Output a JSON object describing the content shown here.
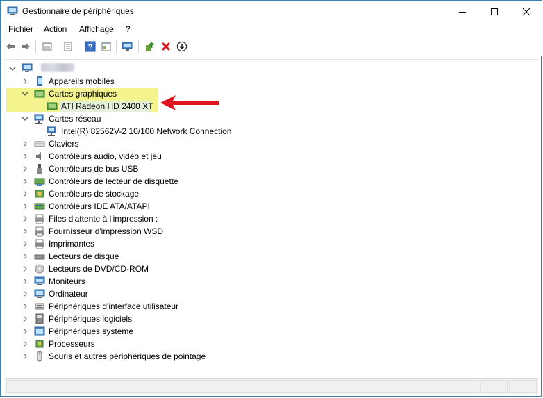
{
  "window": {
    "title": "Gestionnaire de périphériques"
  },
  "menu": [
    {
      "label": "Fichier"
    },
    {
      "label": "Action"
    },
    {
      "label": "Affichage"
    },
    {
      "label": "?"
    }
  ],
  "toolbar": {
    "buttons": [
      "back-icon",
      "forward-icon",
      "properties-icon",
      "update-list-icon",
      "help-icon",
      "view-icon",
      "scan-computer-icon",
      "update-driver-icon",
      "uninstall-icon",
      "disable-icon"
    ]
  },
  "tree": {
    "root_label_blurred": true,
    "categories": [
      {
        "label": "Appareils mobiles",
        "icon": "mobile-icon",
        "expanded": false
      },
      {
        "label": "Cartes graphiques",
        "icon": "display-adapter-icon",
        "expanded": true,
        "children": [
          {
            "label": "ATI Radeon HD 2400 XT",
            "icon": "display-adapter-icon",
            "selected": true
          }
        ]
      },
      {
        "label": "Cartes réseau",
        "icon": "network-icon",
        "expanded": true,
        "children": [
          {
            "label": "Intel(R) 82562V-2 10/100 Network Connection",
            "icon": "network-icon"
          }
        ]
      },
      {
        "label": "Claviers",
        "icon": "keyboard-icon",
        "expanded": false
      },
      {
        "label": "Contrôleurs audio, vidéo et jeu",
        "icon": "speaker-icon",
        "expanded": false
      },
      {
        "label": "Contrôleurs de bus USB",
        "icon": "usb-icon",
        "expanded": false
      },
      {
        "label": "Contrôleurs de lecteur de disquette",
        "icon": "floppy-controller-icon",
        "expanded": false
      },
      {
        "label": "Contrôleurs de stockage",
        "icon": "storage-controller-icon",
        "expanded": false
      },
      {
        "label": "Contrôleurs IDE ATA/ATAPI",
        "icon": "ide-icon",
        "expanded": false
      },
      {
        "label": "Files d'attente à l'impression :",
        "icon": "print-queue-icon",
        "expanded": false
      },
      {
        "label": "Fournisseur d'impression WSD",
        "icon": "printer-icon",
        "expanded": false
      },
      {
        "label": "Imprimantes",
        "icon": "printer-icon",
        "expanded": false
      },
      {
        "label": "Lecteurs de disque",
        "icon": "disk-drive-icon",
        "expanded": false
      },
      {
        "label": "Lecteurs de DVD/CD-ROM",
        "icon": "dvd-icon",
        "expanded": false
      },
      {
        "label": "Moniteurs",
        "icon": "monitor-icon",
        "expanded": false
      },
      {
        "label": "Ordinateur",
        "icon": "computer-icon",
        "expanded": false
      },
      {
        "label": "Périphériques d'interface utilisateur",
        "icon": "hid-icon",
        "expanded": false
      },
      {
        "label": "Périphériques logiciels",
        "icon": "software-device-icon",
        "expanded": false
      },
      {
        "label": "Périphériques système",
        "icon": "system-device-icon",
        "expanded": false
      },
      {
        "label": "Processeurs",
        "icon": "processor-icon",
        "expanded": false
      },
      {
        "label": "Souris et autres périphériques de pointage",
        "icon": "mouse-icon",
        "expanded": false
      }
    ]
  },
  "annotation": {
    "highlight_color": "#f1f27a",
    "arrow_color": "#e0141e"
  }
}
